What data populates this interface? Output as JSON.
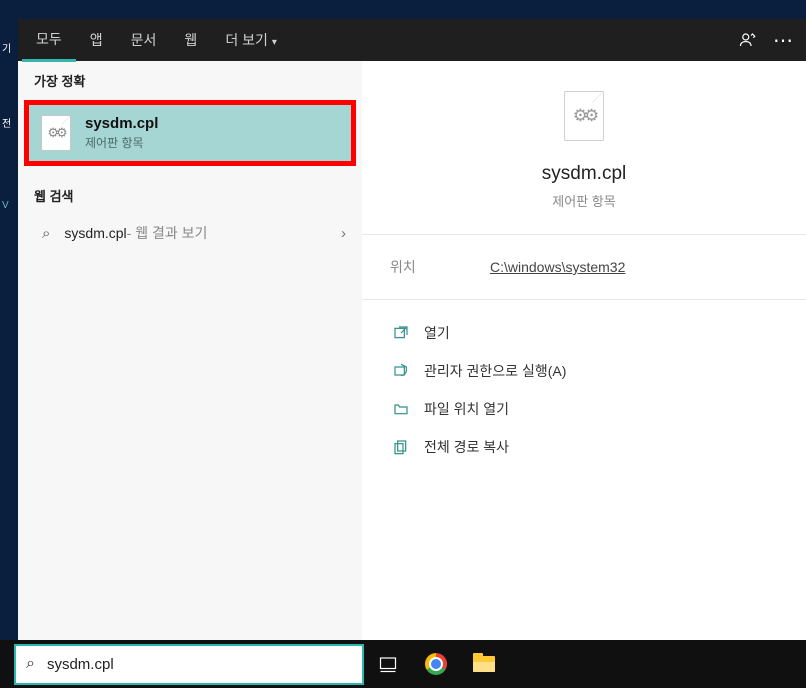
{
  "tabs": {
    "items": [
      "모두",
      "앱",
      "문서",
      "웹",
      "더 보기"
    ],
    "active_index": 0
  },
  "sections": {
    "best_match": "가장 정확",
    "web_search": "웹 검색"
  },
  "best_match": {
    "title": "sysdm.cpl",
    "subtitle": "제어판 항목",
    "icon": "gear-file-icon"
  },
  "web_row": {
    "term": "sysdm.cpl",
    "suffix": " - 웹 결과 보기"
  },
  "preview": {
    "title": "sysdm.cpl",
    "subtitle": "제어판 항목"
  },
  "location": {
    "label": "위치",
    "value": "C:\\windows\\system32"
  },
  "actions": [
    {
      "icon": "open-icon",
      "label": "열기"
    },
    {
      "icon": "admin-run-icon",
      "label": "관리자 권한으로 실행(A)"
    },
    {
      "icon": "folder-open-icon",
      "label": "파일 위치 열기"
    },
    {
      "icon": "copy-path-icon",
      "label": "전체 경로 복사"
    }
  ],
  "searchbox": {
    "value": "sysdm.cpl"
  },
  "glyphs": {
    "more_chevron": "▾",
    "search": "🔍",
    "chevron_right": "›",
    "ellipsis": "⋯"
  }
}
